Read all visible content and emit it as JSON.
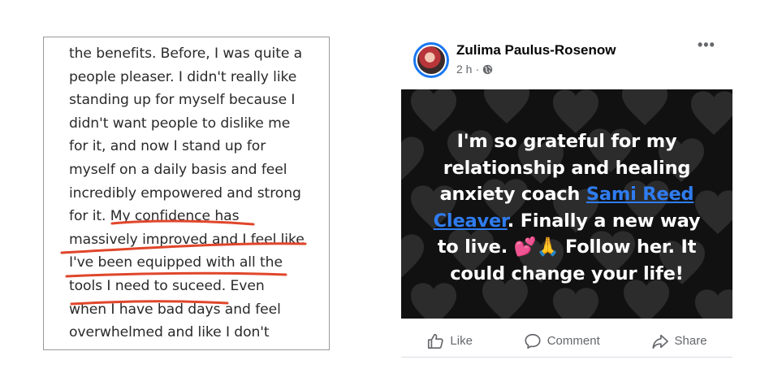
{
  "excerpt": {
    "lines": [
      "the benefits. Before, I was quite a",
      "people pleaser. I didn't really like",
      "standing up for myself because I",
      "didn't want people to dislike me",
      "for it, and now I stand up for",
      "myself on a daily basis and feel",
      "incredibly empowered and strong",
      "for it. My confidence has",
      "massively improved and I feel like",
      "I've been equipped with all the",
      "tools I need to suceed. Even",
      "when I have bad days and feel",
      "overwhelmed and like I don't"
    ],
    "underline_color": "#e0462b"
  },
  "post": {
    "author": "Zulima Paulus-Rosenow",
    "time": "2 h",
    "separator": "·",
    "more": "•••",
    "image_text": {
      "line1": "I'm so grateful for my",
      "line2": "relationship and healing",
      "line3_before": "anxiety coach ",
      "mention_part1": "Sami Reed",
      "mention_part2": "Cleaver",
      "line4_after": ". Finally a new way",
      "line5_before": "to live. ",
      "emoji": "💕🙏",
      "line5_after": " Follow her. It",
      "line6": "could change your life!"
    },
    "actions": {
      "like": "Like",
      "comment": "Comment",
      "share": "Share"
    },
    "colors": {
      "mention": "#2f7cf0",
      "avatar_ring": "#1877f2",
      "action_text": "#65676b"
    }
  }
}
